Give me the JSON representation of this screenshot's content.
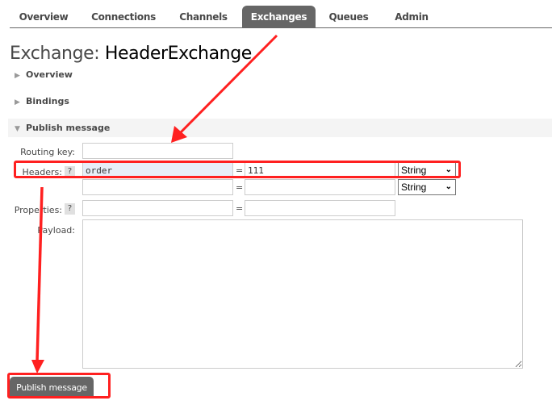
{
  "nav": {
    "tabs": [
      {
        "label": "Overview",
        "active": false
      },
      {
        "label": "Connections",
        "active": false
      },
      {
        "label": "Channels",
        "active": false
      },
      {
        "label": "Exchanges",
        "active": true
      },
      {
        "label": "Queues",
        "active": false
      },
      {
        "label": "Admin",
        "active": false
      }
    ]
  },
  "page": {
    "title_prefix": "Exchange:",
    "title_name": "HeaderExchange"
  },
  "sections": {
    "overview": {
      "label": "Overview",
      "expanded": false
    },
    "bindings": {
      "label": "Bindings",
      "expanded": false
    },
    "publish": {
      "label": "Publish message",
      "expanded": true
    }
  },
  "form": {
    "routing_key_label": "Routing key:",
    "routing_key_value": "",
    "headers_label": "Headers:",
    "help_glyph": "?",
    "equals": "=",
    "headers": [
      {
        "key": "order",
        "value": "111",
        "type": "String"
      },
      {
        "key": "",
        "value": "",
        "type": "String"
      }
    ],
    "properties_label": "Properties:",
    "properties": [
      {
        "key": "",
        "value": ""
      }
    ],
    "payload_label": "Payload:",
    "payload_value": "",
    "publish_button": "Publish message"
  },
  "annotations": {
    "color": "#ff2020",
    "highlighted": [
      "headers-row",
      "publish-button"
    ]
  }
}
